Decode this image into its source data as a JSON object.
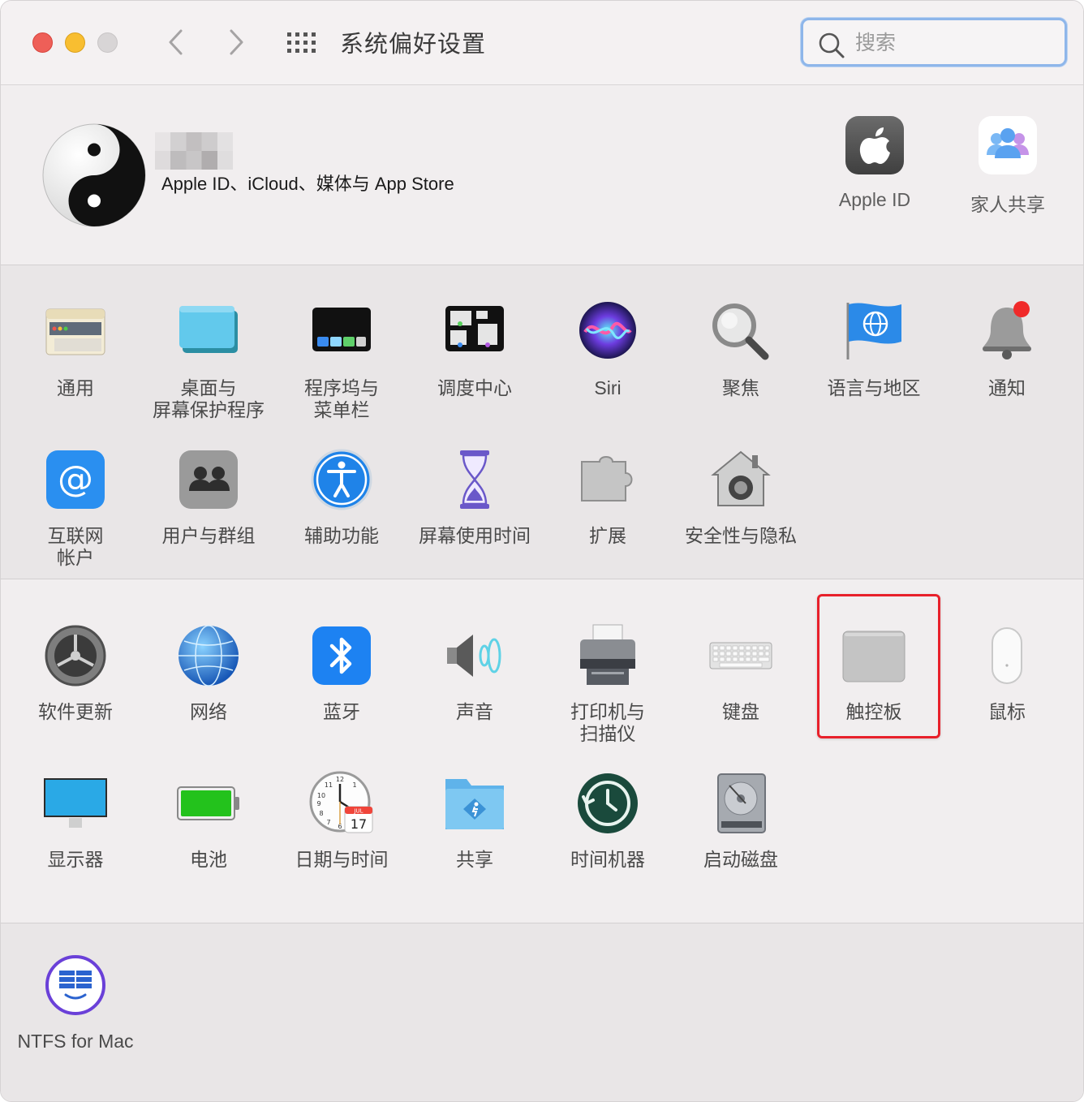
{
  "window": {
    "title": "系统偏好设置",
    "search_placeholder": "搜索"
  },
  "account": {
    "subtitle": "Apple ID、iCloud、媒体与 App Store",
    "items": [
      {
        "label": "Apple ID",
        "icon": "apple-logo-icon"
      },
      {
        "label": "家人共享",
        "icon": "family-sharing-icon"
      }
    ]
  },
  "panes_row1": [
    {
      "label": "通用",
      "icon": "general-icon"
    },
    {
      "label": "桌面与\n屏幕保护程序",
      "icon": "desktop-screensaver-icon"
    },
    {
      "label": "程序坞与\n菜单栏",
      "icon": "dock-menubar-icon"
    },
    {
      "label": "调度中心",
      "icon": "mission-control-icon"
    },
    {
      "label": "Siri",
      "icon": "siri-icon"
    },
    {
      "label": "聚焦",
      "icon": "spotlight-icon"
    },
    {
      "label": "语言与地区",
      "icon": "language-region-icon"
    },
    {
      "label": "通知",
      "icon": "notifications-icon"
    }
  ],
  "panes_row2": [
    {
      "label": "互联网\n帐户",
      "icon": "internet-accounts-icon"
    },
    {
      "label": "用户与群组",
      "icon": "users-groups-icon"
    },
    {
      "label": "辅助功能",
      "icon": "accessibility-icon"
    },
    {
      "label": "屏幕使用时间",
      "icon": "screen-time-icon"
    },
    {
      "label": "扩展",
      "icon": "extensions-icon"
    },
    {
      "label": "安全性与隐私",
      "icon": "security-privacy-icon"
    }
  ],
  "panes_row3": [
    {
      "label": "软件更新",
      "icon": "software-update-icon"
    },
    {
      "label": "网络",
      "icon": "network-icon"
    },
    {
      "label": "蓝牙",
      "icon": "bluetooth-icon"
    },
    {
      "label": "声音",
      "icon": "sound-icon"
    },
    {
      "label": "打印机与\n扫描仪",
      "icon": "printers-scanners-icon"
    },
    {
      "label": "键盘",
      "icon": "keyboard-icon"
    },
    {
      "label": "触控板",
      "icon": "trackpad-icon"
    },
    {
      "label": "鼠标",
      "icon": "mouse-icon"
    }
  ],
  "panes_row4": [
    {
      "label": "显示器",
      "icon": "displays-icon"
    },
    {
      "label": "电池",
      "icon": "battery-icon"
    },
    {
      "label": "日期与时间",
      "icon": "date-time-icon",
      "calendar_month": "JUL",
      "calendar_day": "17"
    },
    {
      "label": "共享",
      "icon": "sharing-icon"
    },
    {
      "label": "时间机器",
      "icon": "time-machine-icon"
    },
    {
      "label": "启动磁盘",
      "icon": "startup-disk-icon"
    }
  ],
  "panes_third_party": [
    {
      "label": "NTFS for Mac",
      "icon": "ntfs-for-mac-icon"
    }
  ],
  "colors": {
    "highlight": "#e8202a",
    "search_focus": "#8eb6ea"
  }
}
